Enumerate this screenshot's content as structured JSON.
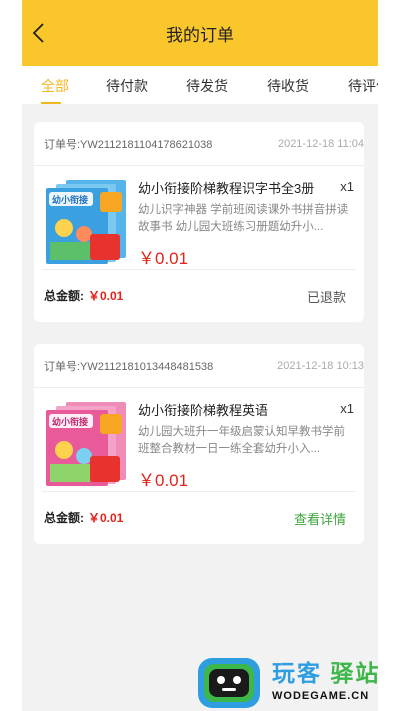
{
  "header": {
    "title": "我的订单",
    "back_icon": "chevron-left-icon"
  },
  "tabs": [
    {
      "label": "全部",
      "active": true
    },
    {
      "label": "待付款"
    },
    {
      "label": "待发货"
    },
    {
      "label": "待收货"
    },
    {
      "label": "待评价"
    }
  ],
  "orders": [
    {
      "order_no": "订单号:YW2112181104178621038",
      "date": "2021-12-18 11:04",
      "item": {
        "title": "幼小衔接阶梯教程识字书全3册",
        "qty": "x1",
        "desc": "幼儿识字神器 学前班阅读课外书拼音拼读故事书 幼儿园大班练习册题幼升小...",
        "price": "￥0.01",
        "cover_text": "幼小衔接",
        "cover_color": "#3aa0e0"
      },
      "total_label": "总金额:",
      "total_value": "￥0.01",
      "status": "已退款"
    },
    {
      "order_no": "订单号:YW2112181013448481538",
      "date": "2021-12-18 10:13",
      "item": {
        "title": "幼小衔接阶梯教程英语",
        "qty": "x1",
        "desc": "幼儿园大班升一年级启蒙认知早教书学前班整合教材一日一练全套幼升小入...",
        "price": "￥0.01",
        "cover_text": "幼小衔接",
        "cover_color": "#e85a9a"
      },
      "total_label": "总金额:",
      "total_value": "￥0.01",
      "action": "查看详情"
    }
  ],
  "watermark": {
    "cn_part1": "玩客",
    "cn_part2": "驿站",
    "en": "WODEGAME.CN"
  },
  "colors": {
    "header": "#f9c62b",
    "accent": "#f2b822",
    "price": "#e2231a",
    "link": "#3da33b"
  }
}
